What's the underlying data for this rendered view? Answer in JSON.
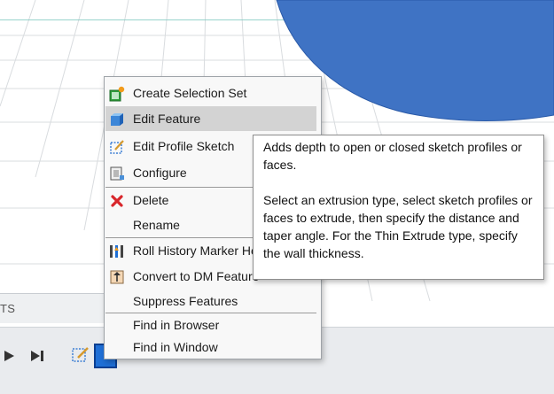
{
  "viewport": {
    "browser_panel_label": "TS"
  },
  "context_menu": {
    "items": [
      {
        "label": "Create Selection Set",
        "icon": "selection-set-icon"
      },
      {
        "label": "Edit Feature",
        "icon": "extrude-feature-icon",
        "highlighted": true
      },
      {
        "label": "Edit Profile Sketch",
        "icon": "profile-sketch-icon"
      },
      {
        "label": "Configure",
        "icon": "configure-icon"
      },
      {
        "label": "Delete",
        "icon": "delete-x-icon"
      },
      {
        "label": "Rename",
        "icon": ""
      },
      {
        "label": "Roll History Marker He",
        "icon": "roll-history-marker-icon"
      },
      {
        "label": "Convert to DM Feature",
        "icon": "convert-dm-feature-icon"
      },
      {
        "label": "Suppress Features",
        "icon": ""
      },
      {
        "label": "Find in Browser",
        "icon": ""
      },
      {
        "label": "Find in Window",
        "icon": ""
      }
    ]
  },
  "tooltip": {
    "paragraph1": "Adds depth to open or closed sketch profiles or faces.",
    "paragraph2": "Select an extrusion type, select sketch profiles or faces to extrude, then specify the distance and taper angle. For the Thin Extrude type, specify the wall thickness."
  },
  "timeline": {
    "play_icon": "play-icon",
    "end_icon": "skip-to-end-icon"
  },
  "colors": {
    "part_blue": "#3f73c4",
    "menu_highlight": "#d3d3d3",
    "delete_red": "#d8262b"
  }
}
